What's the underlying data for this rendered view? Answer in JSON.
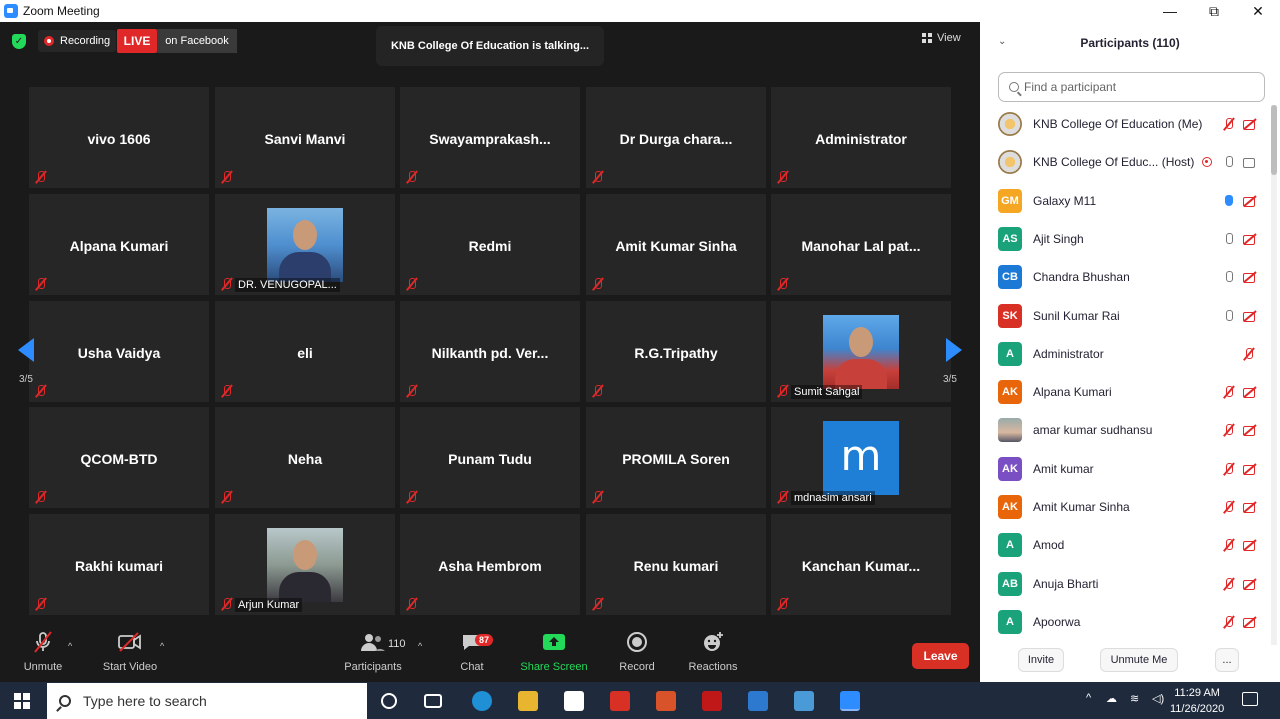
{
  "window": {
    "title": "Zoom Meeting",
    "minimize": "—",
    "maximize": "⧉",
    "close": "✕"
  },
  "topbar": {
    "recording": "Recording",
    "live": "LIVE",
    "on_facebook": "on Facebook",
    "talking": "KNB College Of Education is talking...",
    "view": "View"
  },
  "gallery": {
    "page_left": "3/5",
    "page_right": "3/5",
    "tiles": [
      {
        "name": "vivo 1606"
      },
      {
        "name": "Sanvi Manvi"
      },
      {
        "name": "Swayamprakash..."
      },
      {
        "name": "Dr Durga chara..."
      },
      {
        "name": "Administrator"
      },
      {
        "name": "Alpana Kumari"
      },
      {
        "label": "DR. VENUGOPAL..."
      },
      {
        "name": "Redmi"
      },
      {
        "name": "Amit Kumar Sinha"
      },
      {
        "name": "Manohar Lal pat..."
      },
      {
        "name": "Usha Vaidya"
      },
      {
        "name": "eli"
      },
      {
        "name": "Nilkanth pd. Ver..."
      },
      {
        "name": "R.G.Tripathy"
      },
      {
        "label": "Sumit Sahgal"
      },
      {
        "name": "QCOM-BTD"
      },
      {
        "name": "Neha"
      },
      {
        "name": "Punam Tudu"
      },
      {
        "name": "PROMILA Soren"
      },
      {
        "label": "mdnasim ansari",
        "letter": "m"
      },
      {
        "name": "Rakhi kumari"
      },
      {
        "label": "Arjun Kumar"
      },
      {
        "name": "Asha Hembrom"
      },
      {
        "name": "Renu kumari"
      },
      {
        "name": "Kanchan Kumar..."
      }
    ]
  },
  "toolbar": {
    "unmute": "Unmute",
    "start_video": "Start Video",
    "participants": "Participants",
    "participants_count": "110",
    "chat": "Chat",
    "chat_badge": "87",
    "share_screen": "Share Screen",
    "record": "Record",
    "reactions": "Reactions",
    "leave": "Leave"
  },
  "panel": {
    "title": "Participants (110)",
    "search_placeholder": "Find a participant",
    "participants": [
      {
        "name": "KNB College Of Education (Me)",
        "avatar": "",
        "color": "",
        "mic": "muted",
        "cam": "off"
      },
      {
        "name": "KNB College Of Educ... (Host)",
        "avatar": "",
        "color": "",
        "mic": "on",
        "cam": "on"
      },
      {
        "name": "Galaxy M11",
        "avatar": "GM",
        "color": "#f5a623",
        "mic": "raise",
        "cam": "off"
      },
      {
        "name": "Ajit Singh",
        "avatar": "AS",
        "color": "#1aa37a",
        "mic": "on",
        "cam": "off"
      },
      {
        "name": "Chandra Bhushan",
        "avatar": "CB",
        "color": "#1c7ad6",
        "mic": "on",
        "cam": "off"
      },
      {
        "name": "Sunil Kumar Rai",
        "avatar": "SK",
        "color": "#d93025",
        "mic": "on",
        "cam": "off"
      },
      {
        "name": "Administrator",
        "avatar": "A",
        "color": "#1aa37a",
        "mic": "none",
        "cam": "muted-only"
      },
      {
        "name": "Alpana Kumari",
        "avatar": "AK",
        "color": "#e8650a",
        "mic": "muted",
        "cam": "off"
      },
      {
        "name": "amar kumar sudhansu",
        "avatar": "",
        "color": "",
        "mic": "muted",
        "cam": "off"
      },
      {
        "name": "Amit kumar",
        "avatar": "AK",
        "color": "#7b4fc4",
        "mic": "muted",
        "cam": "off"
      },
      {
        "name": "Amit Kumar Sinha",
        "avatar": "AK",
        "color": "#e8650a",
        "mic": "muted",
        "cam": "off"
      },
      {
        "name": "Amod",
        "avatar": "A",
        "color": "#1aa37a",
        "mic": "muted",
        "cam": "off"
      },
      {
        "name": "Anuja Bharti",
        "avatar": "AB",
        "color": "#1aa37a",
        "mic": "muted",
        "cam": "off"
      },
      {
        "name": "Apoorwa",
        "avatar": "A",
        "color": "#1aa37a",
        "mic": "muted",
        "cam": "off"
      }
    ],
    "invite": "Invite",
    "unmute_me": "Unmute Me",
    "more": "..."
  },
  "taskbar": {
    "search_text": "Type here to search",
    "time": "11:29 AM",
    "date": "11/26/2020"
  }
}
